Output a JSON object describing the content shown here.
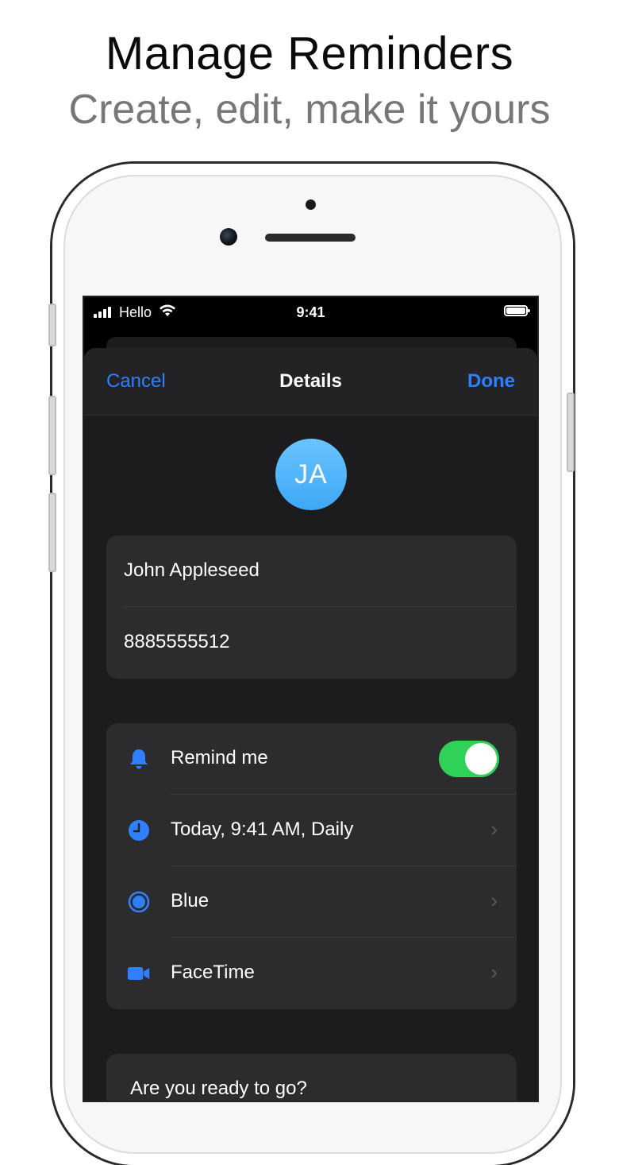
{
  "promo": {
    "headline": "Manage Reminders",
    "subheadline": "Create, edit, make it yours"
  },
  "status_bar": {
    "carrier": "Hello",
    "time": "9:41"
  },
  "nav": {
    "cancel_label": "Cancel",
    "title": "Details",
    "done_label": "Done"
  },
  "contact": {
    "initials": "JA",
    "name": "John Appleseed",
    "phone": "8885555512"
  },
  "settings": {
    "remind_me_label": "Remind me",
    "remind_me_enabled": true,
    "schedule_label": "Today, 9:41 AM, Daily",
    "color_label": "Blue",
    "call_type_label": "FaceTime"
  },
  "message": {
    "text": "Are you ready to go?"
  },
  "colors": {
    "accent": "#2f80ff",
    "toggle_on": "#30d158",
    "avatar": "#4fb3fa"
  }
}
